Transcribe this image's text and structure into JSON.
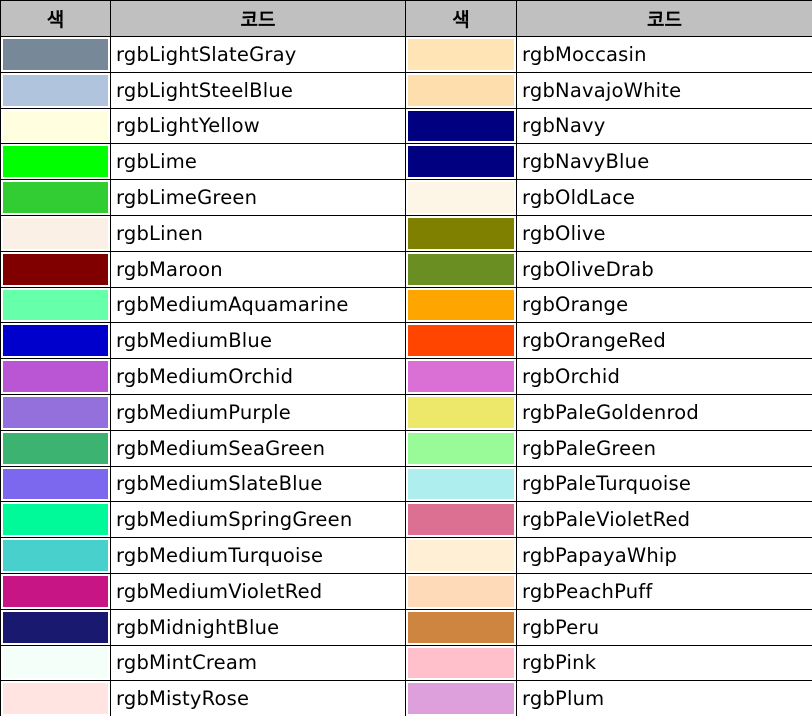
{
  "header": {
    "color_label_1": "색",
    "code_label_1": "코드",
    "color_label_2": "색",
    "code_label_2": "코드"
  },
  "rows": [
    {
      "left": {
        "name": "rgbLightSlateGray",
        "color": "#778899"
      },
      "right": {
        "name": "rgbMoccasin",
        "color": "#FFE4B5"
      }
    },
    {
      "left": {
        "name": "rgbLightSteelBlue",
        "color": "#B0C4DE"
      },
      "right": {
        "name": "rgbNavajoWhite",
        "color": "#FFDEAD"
      }
    },
    {
      "left": {
        "name": "rgbLightYellow",
        "color": "#FFFFE0"
      },
      "right": {
        "name": "rgbNavy",
        "color": "#000080"
      }
    },
    {
      "left": {
        "name": "rgbLime",
        "color": "#00FF00"
      },
      "right": {
        "name": "rgbNavyBlue",
        "color": "#000080"
      }
    },
    {
      "left": {
        "name": "rgbLimeGreen",
        "color": "#32CD32"
      },
      "right": {
        "name": "rgbOldLace",
        "color": "#FDF5E6"
      }
    },
    {
      "left": {
        "name": "rgbLinen",
        "color": "#FAF0E6"
      },
      "right": {
        "name": "rgbOlive",
        "color": "#808000"
      }
    },
    {
      "left": {
        "name": "rgbMaroon",
        "color": "#800000"
      },
      "right": {
        "name": "rgbOliveDrab",
        "color": "#6B8E23"
      }
    },
    {
      "left": {
        "name": "rgbMediumAquamarine",
        "color": "#66FFAA"
      },
      "right": {
        "name": "rgbOrange",
        "color": "#FFA500"
      }
    },
    {
      "left": {
        "name": "rgbMediumBlue",
        "color": "#0000CD"
      },
      "right": {
        "name": "rgbOrangeRed",
        "color": "#FF4500"
      }
    },
    {
      "left": {
        "name": "rgbMediumOrchid",
        "color": "#BA55D3"
      },
      "right": {
        "name": "rgbOrchid",
        "color": "#DA70D6"
      }
    },
    {
      "left": {
        "name": "rgbMediumPurple",
        "color": "#9370DB"
      },
      "right": {
        "name": "rgbPaleGoldenrod",
        "color": "#EEE86A"
      }
    },
    {
      "left": {
        "name": "rgbMediumSeaGreen",
        "color": "#3CB371"
      },
      "right": {
        "name": "rgbPaleGreen",
        "color": "#98FB98"
      }
    },
    {
      "left": {
        "name": "rgbMediumSlateBlue",
        "color": "#7B68EE"
      },
      "right": {
        "name": "rgbPaleTurquoise",
        "color": "#AFEEEE"
      }
    },
    {
      "left": {
        "name": "rgbMediumSpringGreen",
        "color": "#00FA9A"
      },
      "right": {
        "name": "rgbPaleVioletRed",
        "color": "#DB7093"
      }
    },
    {
      "left": {
        "name": "rgbMediumTurquoise",
        "color": "#48D1CC"
      },
      "right": {
        "name": "rgbPapayaWhip",
        "color": "#FFEFD5"
      }
    },
    {
      "left": {
        "name": "rgbMediumVioletRed",
        "color": "#C71585"
      },
      "right": {
        "name": "rgbPeachPuff",
        "color": "#FFDAB9"
      }
    },
    {
      "left": {
        "name": "rgbMidnightBlue",
        "color": "#191970"
      },
      "right": {
        "name": "rgbPeru",
        "color": "#CD853F"
      }
    },
    {
      "left": {
        "name": "rgbMintCream",
        "color": "#F5FFFA"
      },
      "right": {
        "name": "rgbPink",
        "color": "#FFC0CB"
      }
    },
    {
      "left": {
        "name": "rgbMistyRose",
        "color": "#FFE4E1"
      },
      "right": {
        "name": "rgbPlum",
        "color": "#DDA0DD"
      }
    }
  ]
}
